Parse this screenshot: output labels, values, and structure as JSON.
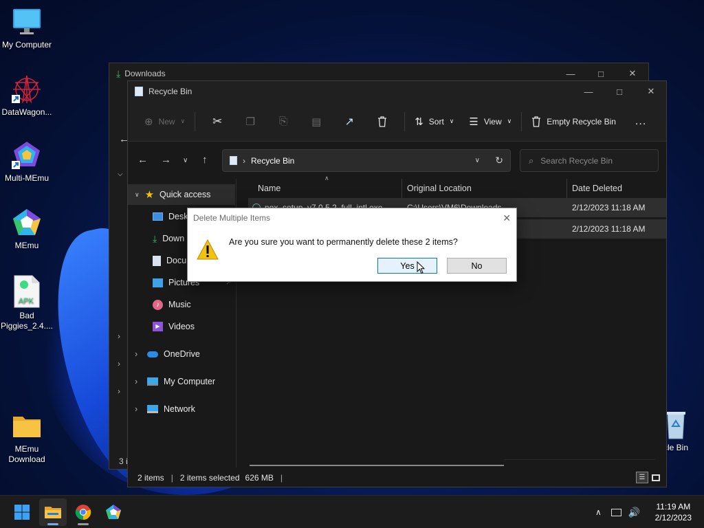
{
  "desktop": {
    "icons": [
      {
        "label": "My Computer"
      },
      {
        "label": "DataWagon..."
      },
      {
        "label": "Multi-MEmu"
      },
      {
        "label": "MEmu"
      },
      {
        "label": "Bad Piggies_2.4....",
        "badge": "APK"
      },
      {
        "label": "MEmu Download"
      },
      {
        "label": "cle Bin"
      }
    ]
  },
  "bg_window": {
    "title": "Downloads",
    "status": "3 i"
  },
  "window": {
    "title": "Recycle Bin",
    "toolbar": {
      "new_label": "New",
      "sort_label": "Sort",
      "view_label": "View",
      "empty_label": "Empty Recycle Bin",
      "more_label": "..."
    },
    "address": {
      "path": "Recycle Bin",
      "search_placeholder": "Search Recycle Bin"
    },
    "sidebar": {
      "quick_access": "Quick access",
      "items": [
        {
          "label": "Deskt"
        },
        {
          "label": "Down"
        },
        {
          "label": "Docu"
        },
        {
          "label": "Pictures"
        },
        {
          "label": "Music"
        },
        {
          "label": "Videos"
        },
        {
          "label": "OneDrive"
        },
        {
          "label": "My Computer"
        },
        {
          "label": "Network"
        }
      ]
    },
    "columns": {
      "name": "Name",
      "original_location": "Original Location",
      "date_deleted": "Date Deleted"
    },
    "rows": [
      {
        "name": "nox_setup_v7.0.5.2_full_intl.exe",
        "location": "C:\\Users\\VM6\\Downloads",
        "date": "2/12/2023 11:18 AM"
      },
      {
        "name": "",
        "location": "",
        "date": "2/12/2023 11:18 AM"
      }
    ],
    "status": {
      "count": "2 items",
      "selected": "2 items selected",
      "size": "626 MB"
    }
  },
  "dialog": {
    "title": "Delete Multiple Items",
    "message": "Are you sure you want to permanently delete these 2 items?",
    "yes_label": "Yes",
    "no_label": "No"
  },
  "taskbar": {
    "time": "11:19 AM",
    "date": "2/12/2023"
  },
  "colors": {
    "accent": "#0078d7",
    "folder_yellow": "#f6c342",
    "warning_yellow": "#f4c20d"
  }
}
